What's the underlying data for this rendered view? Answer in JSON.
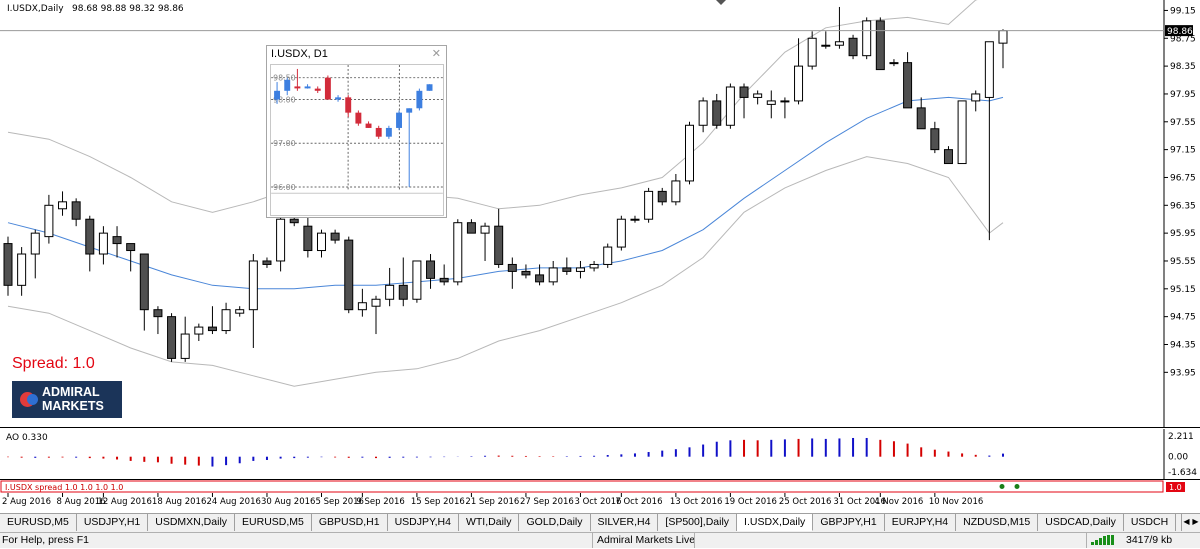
{
  "main_chart": {
    "header_symbol": "I.USDX,Daily",
    "header_ohlc": "98.68 98.88 98.32 98.86",
    "current_price_label": "98.86",
    "current_price": 98.86,
    "spread_text": "Spread:  1.0",
    "logo_line1": "ADMIRAL",
    "logo_line2": "MARKETS",
    "chart_data": {
      "type": "candlestick",
      "ylim": [
        93.15,
        99.3
      ],
      "yticks": [
        "99.15",
        "98.75",
        "98.35",
        "97.95",
        "97.55",
        "97.15",
        "96.75",
        "96.35",
        "95.95",
        "95.55",
        "95.15",
        "94.75",
        "94.35",
        "93.95"
      ],
      "candles": [
        [
          95.8,
          95.9,
          95.05,
          95.2
        ],
        [
          95.2,
          95.75,
          95.05,
          95.65
        ],
        [
          95.65,
          96.0,
          95.3,
          95.95
        ],
        [
          95.9,
          96.5,
          95.8,
          96.35
        ],
        [
          96.3,
          96.55,
          96.2,
          96.4
        ],
        [
          96.4,
          96.45,
          96.05,
          96.15
        ],
        [
          96.15,
          96.2,
          95.4,
          95.65
        ],
        [
          95.65,
          96.05,
          95.5,
          95.95
        ],
        [
          95.9,
          96.05,
          95.6,
          95.8
        ],
        [
          95.8,
          95.8,
          95.4,
          95.7
        ],
        [
          95.65,
          95.65,
          94.55,
          94.85
        ],
        [
          94.85,
          94.9,
          94.5,
          94.75
        ],
        [
          94.75,
          94.8,
          94.1,
          94.15
        ],
        [
          94.15,
          94.75,
          94.1,
          94.5
        ],
        [
          94.5,
          94.65,
          94.4,
          94.6
        ],
        [
          94.6,
          94.9,
          94.5,
          94.55
        ],
        [
          94.55,
          94.95,
          94.5,
          94.85
        ],
        [
          94.8,
          94.9,
          94.75,
          94.85
        ],
        [
          94.85,
          95.65,
          94.3,
          95.55
        ],
        [
          95.55,
          95.6,
          95.45,
          95.5
        ],
        [
          95.55,
          96.2,
          95.4,
          96.15
        ],
        [
          96.15,
          96.2,
          96.05,
          96.1
        ],
        [
          96.05,
          96.2,
          95.6,
          95.7
        ],
        [
          95.7,
          96.0,
          95.6,
          95.95
        ],
        [
          95.95,
          96.0,
          95.8,
          95.85
        ],
        [
          95.85,
          95.9,
          94.8,
          94.85
        ],
        [
          94.85,
          95.15,
          94.75,
          94.95
        ],
        [
          94.9,
          95.05,
          94.5,
          95.0
        ],
        [
          95.0,
          95.45,
          94.9,
          95.2
        ],
        [
          95.2,
          95.6,
          94.9,
          95.0
        ],
        [
          95.0,
          95.5,
          94.95,
          95.55
        ],
        [
          95.55,
          95.65,
          95.15,
          95.3
        ],
        [
          95.3,
          95.5,
          95.2,
          95.25
        ],
        [
          95.25,
          96.15,
          95.2,
          96.1
        ],
        [
          96.1,
          96.15,
          95.95,
          95.95
        ],
        [
          95.95,
          96.1,
          95.55,
          96.05
        ],
        [
          96.05,
          96.3,
          95.45,
          95.5
        ],
        [
          95.5,
          95.6,
          95.15,
          95.4
        ],
        [
          95.4,
          95.5,
          95.3,
          95.35
        ],
        [
          95.35,
          95.5,
          95.2,
          95.25
        ],
        [
          95.25,
          95.55,
          95.2,
          95.45
        ],
        [
          95.45,
          95.6,
          95.35,
          95.4
        ],
        [
          95.4,
          95.55,
          95.3,
          95.45
        ],
        [
          95.45,
          95.55,
          95.4,
          95.5
        ],
        [
          95.5,
          95.8,
          95.45,
          95.75
        ],
        [
          95.75,
          96.2,
          95.7,
          96.15
        ],
        [
          96.15,
          96.2,
          96.1,
          96.15
        ],
        [
          96.15,
          96.6,
          96.1,
          96.55
        ],
        [
          96.55,
          96.6,
          96.35,
          96.4
        ],
        [
          96.4,
          96.8,
          96.35,
          96.7
        ],
        [
          96.7,
          97.55,
          96.65,
          97.5
        ],
        [
          97.5,
          97.9,
          97.4,
          97.85
        ],
        [
          97.85,
          97.95,
          97.45,
          97.5
        ],
        [
          97.5,
          98.1,
          97.45,
          98.05
        ],
        [
          98.05,
          98.1,
          97.6,
          97.9
        ],
        [
          97.9,
          98.0,
          97.8,
          97.95
        ],
        [
          97.8,
          98.0,
          97.6,
          97.85
        ],
        [
          97.85,
          97.9,
          97.6,
          97.85
        ],
        [
          97.85,
          98.75,
          97.8,
          98.35
        ],
        [
          98.35,
          98.85,
          98.3,
          98.75
        ],
        [
          98.65,
          98.85,
          98.6,
          98.65
        ],
        [
          98.65,
          99.2,
          98.6,
          98.7
        ],
        [
          98.75,
          98.8,
          98.45,
          98.5
        ],
        [
          98.5,
          99.05,
          98.45,
          99.0
        ],
        [
          99.0,
          99.05,
          98.3,
          98.3
        ],
        [
          98.4,
          98.45,
          98.35,
          98.4
        ],
        [
          98.4,
          98.55,
          97.75,
          97.75
        ],
        [
          97.75,
          97.9,
          97.45,
          97.45
        ],
        [
          97.45,
          97.55,
          97.1,
          97.15
        ],
        [
          97.15,
          97.2,
          96.95,
          96.95
        ],
        [
          96.95,
          97.8,
          96.95,
          97.85
        ],
        [
          97.85,
          98.0,
          97.7,
          97.95
        ],
        [
          97.9,
          97.95,
          95.85,
          98.7
        ],
        [
          98.68,
          98.88,
          98.32,
          98.86
        ]
      ],
      "moving_average": [
        [
          0,
          96.1
        ],
        [
          3,
          95.95
        ],
        [
          6,
          95.75
        ],
        [
          9,
          95.55
        ],
        [
          12,
          95.35
        ],
        [
          15,
          95.2
        ],
        [
          18,
          95.15
        ],
        [
          21,
          95.15
        ],
        [
          24,
          95.2
        ],
        [
          27,
          95.2
        ],
        [
          30,
          95.25
        ],
        [
          33,
          95.3
        ],
        [
          36,
          95.4
        ],
        [
          39,
          95.45
        ],
        [
          42,
          95.45
        ],
        [
          45,
          95.55
        ],
        [
          48,
          95.7
        ],
        [
          51,
          96.0
        ],
        [
          54,
          96.45
        ],
        [
          57,
          96.85
        ],
        [
          60,
          97.25
        ],
        [
          63,
          97.6
        ],
        [
          66,
          97.85
        ],
        [
          69,
          97.9
        ],
        [
          72,
          97.85
        ],
        [
          73,
          97.9
        ]
      ],
      "band_upper": [
        [
          0,
          97.4
        ],
        [
          3,
          97.3
        ],
        [
          6,
          97.05
        ],
        [
          9,
          96.75
        ],
        [
          12,
          96.4
        ],
        [
          15,
          96.25
        ],
        [
          18,
          96.4
        ],
        [
          21,
          96.6
        ],
        [
          24,
          96.55
        ],
        [
          27,
          96.5
        ],
        [
          30,
          96.5
        ],
        [
          33,
          96.45
        ],
        [
          36,
          96.3
        ],
        [
          39,
          96.35
        ],
        [
          42,
          96.5
        ],
        [
          45,
          96.6
        ],
        [
          48,
          96.75
        ],
        [
          51,
          97.25
        ],
        [
          54,
          97.95
        ],
        [
          57,
          98.55
        ],
        [
          60,
          98.9
        ],
        [
          63,
          99.0
        ],
        [
          66,
          99.05
        ],
        [
          69,
          98.95
        ],
        [
          71,
          99.3
        ],
        [
          73,
          99.4
        ]
      ],
      "band_lower": [
        [
          0,
          94.9
        ],
        [
          3,
          94.8
        ],
        [
          6,
          94.55
        ],
        [
          9,
          94.3
        ],
        [
          12,
          94.1
        ],
        [
          15,
          94.05
        ],
        [
          18,
          93.9
        ],
        [
          21,
          93.75
        ],
        [
          24,
          93.85
        ],
        [
          27,
          93.95
        ],
        [
          30,
          94.0
        ],
        [
          33,
          94.15
        ],
        [
          36,
          94.4
        ],
        [
          39,
          94.55
        ],
        [
          42,
          94.75
        ],
        [
          45,
          94.95
        ],
        [
          48,
          95.2
        ],
        [
          51,
          95.6
        ],
        [
          54,
          96.25
        ],
        [
          57,
          96.6
        ],
        [
          60,
          96.85
        ],
        [
          63,
          97.05
        ],
        [
          66,
          96.95
        ],
        [
          69,
          96.75
        ],
        [
          72,
          95.95
        ],
        [
          73,
          96.1
        ]
      ]
    }
  },
  "mini_window": {
    "title": "I.USDX, D1",
    "close_glyph": "✕",
    "yticks": [
      "98.50",
      "98.00",
      "97.00",
      "96.00"
    ],
    "chart_data": {
      "type": "candlestick",
      "ylim": [
        95.9,
        98.7
      ],
      "candles": [
        [
          98.0,
          98.4,
          97.9,
          98.2
        ],
        [
          98.2,
          98.5,
          98.1,
          98.45
        ],
        [
          98.3,
          98.7,
          98.2,
          98.3
        ],
        [
          98.3,
          98.35,
          98.25,
          98.3
        ],
        [
          98.25,
          98.3,
          98.15,
          98.2
        ],
        [
          98.5,
          98.55,
          98.0,
          98.0
        ],
        [
          98.0,
          98.1,
          97.95,
          98.05
        ],
        [
          98.05,
          98.1,
          97.6,
          97.7
        ],
        [
          97.7,
          97.75,
          97.4,
          97.45
        ],
        [
          97.45,
          97.5,
          97.35,
          97.35
        ],
        [
          97.35,
          97.4,
          97.1,
          97.15
        ],
        [
          97.15,
          97.4,
          97.1,
          97.35
        ],
        [
          97.35,
          97.75,
          97.3,
          97.7
        ],
        [
          97.7,
          97.8,
          96.0,
          97.8
        ],
        [
          97.8,
          98.25,
          97.75,
          98.2
        ],
        [
          98.2,
          98.35,
          98.2,
          98.35
        ]
      ],
      "candle_colors": [
        "#3d7fe0",
        "#3d7fe0",
        "#d22b3a",
        "#3d7fe0",
        "#d22b3a",
        "#d22b3a",
        "#3d7fe0",
        "#d22b3a",
        "#d22b3a",
        "#d22b3a",
        "#d22b3a",
        "#3d7fe0",
        "#3d7fe0",
        "#3d7fe0",
        "#3d7fe0",
        "#3d7fe0"
      ]
    }
  },
  "ao_indicator": {
    "label": "AO 0.330",
    "yticks": [
      "2.211",
      "0.00",
      "-1.634"
    ],
    "chart_data": {
      "type": "bar",
      "ylim": [
        -1.634,
        2.211
      ],
      "values": [
        -0.05,
        -0.1,
        -0.12,
        -0.1,
        -0.08,
        -0.1,
        -0.15,
        -0.2,
        -0.3,
        -0.45,
        -0.55,
        -0.6,
        -0.75,
        -0.85,
        -0.95,
        -1.05,
        -0.9,
        -0.7,
        -0.45,
        -0.35,
        -0.2,
        -0.15,
        -0.1,
        -0.05,
        -0.08,
        -0.12,
        -0.1,
        -0.15,
        -0.12,
        -0.1,
        -0.08,
        -0.06,
        -0.04,
        -0.02,
        0.05,
        0.1,
        0.12,
        0.1,
        0.08,
        0.06,
        0.05,
        0.05,
        0.08,
        0.1,
        0.18,
        0.25,
        0.35,
        0.5,
        0.65,
        0.8,
        1.0,
        1.3,
        1.6,
        1.75,
        1.8,
        1.75,
        1.8,
        1.85,
        1.9,
        1.95,
        1.9,
        1.95,
        2.0,
        2.0,
        1.8,
        1.65,
        1.4,
        1.0,
        0.75,
        0.55,
        0.35,
        0.2,
        0.12,
        0.33
      ],
      "colors": [
        "#d40000",
        "#d40000",
        "#1010c8",
        "#d40000",
        "#d40000",
        "#1010c8",
        "#d40000",
        "#d40000",
        "#d40000",
        "#d40000",
        "#d40000",
        "#d40000",
        "#d40000",
        "#d40000",
        "#d40000",
        "#1010c8",
        "#1010c8",
        "#1010c8",
        "#1010c8",
        "#1010c8",
        "#1010c8",
        "#1010c8",
        "#1010c8",
        "#1010c8",
        "#d40000",
        "#d40000",
        "#1010c8",
        "#d40000",
        "#1010c8",
        "#1010c8",
        "#1010c8",
        "#1010c8",
        "#1010c8",
        "#1010c8",
        "#1010c8",
        "#1010c8",
        "#d40000",
        "#d40000",
        "#d40000",
        "#d40000",
        "#d40000",
        "#1010c8",
        "#1010c8",
        "#1010c8",
        "#1010c8",
        "#1010c8",
        "#1010c8",
        "#1010c8",
        "#1010c8",
        "#1010c8",
        "#1010c8",
        "#1010c8",
        "#1010c8",
        "#1010c8",
        "#d40000",
        "#d40000",
        "#1010c8",
        "#1010c8",
        "#d40000",
        "#1010c8",
        "#1010c8",
        "#1010c8",
        "#1010c8",
        "#1010c8",
        "#d40000",
        "#d40000",
        "#d40000",
        "#d40000",
        "#d40000",
        "#d40000",
        "#d40000",
        "#d40000",
        "#1010c8",
        "#1010c8"
      ]
    }
  },
  "spread_indicator": {
    "label": "I.USDX spread 1.0 1.0 1.0 1.0",
    "value_label": "1.0",
    "accent_color": "#e30613"
  },
  "date_axis": {
    "labels": [
      "2 Aug 2016",
      "8 Aug 2016",
      "12 Aug 2016",
      "18 Aug 2016",
      "24 Aug 2016",
      "30 Aug 2016",
      "5 Sep 2016",
      "9 Sep 2016",
      "15 Sep 2016",
      "21 Sep 2016",
      "27 Sep 2016",
      "3 Oct 2016",
      "7 Oct 2016",
      "13 Oct 2016",
      "19 Oct 2016",
      "25 Oct 2016",
      "31 Oct 2016",
      "4 Nov 2016",
      "10 Nov 2016"
    ]
  },
  "tabs": {
    "items": [
      "EURUSD,M5",
      "USDJPY,H1",
      "USDMXN,Daily",
      "EURUSD,M5",
      "GBPUSD,H1",
      "USDJPY,H4",
      "WTI,Daily",
      "GOLD,Daily",
      "SILVER,H4",
      "[SP500],Daily",
      "I.USDX,Daily",
      "GBPJPY,H1",
      "EURJPY,H4",
      "NZDUSD,M15",
      "USDCAD,Daily",
      "USDCH"
    ],
    "active_index": 10,
    "scroll_left": "◀",
    "scroll_right": "▶"
  },
  "status_bar": {
    "help_text": "For Help, press F1",
    "server_text": "Admiral Markets Live",
    "traffic_text": "3417/9 kb"
  }
}
